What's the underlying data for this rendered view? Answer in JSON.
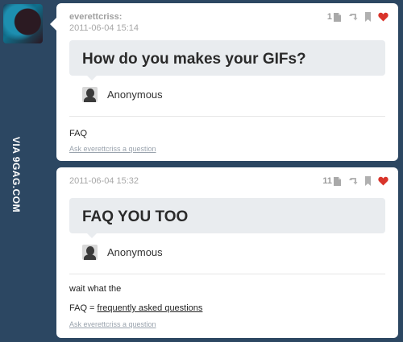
{
  "watermark": "VIA 9GAG.COM",
  "posts": [
    {
      "username": "everettcriss:",
      "timestamp": "2011-06-04 15:14",
      "notes_count": "1",
      "question": "How do you makes your GIFs?",
      "asker": "Anonymous",
      "answer_lines": [
        "FAQ"
      ],
      "ask_link": "Ask everettcriss a question",
      "liked": true
    },
    {
      "timestamp": "2011-06-04 15:32",
      "notes_count": "11",
      "question": "FAQ YOU TOO",
      "asker": "Anonymous",
      "answer_line1": "wait what the",
      "answer_prefix": "FAQ = ",
      "answer_link": "frequently asked questions",
      "ask_link": "Ask everettcriss a question",
      "liked": true
    }
  ],
  "icons": {
    "notes": "notes-icon",
    "reblog": "reblog-icon",
    "bookmark": "bookmark-icon",
    "like": "heart-icon"
  },
  "colors": {
    "background": "#2c4762",
    "heart": "#d9342b",
    "question_bg": "#e9ecef"
  }
}
